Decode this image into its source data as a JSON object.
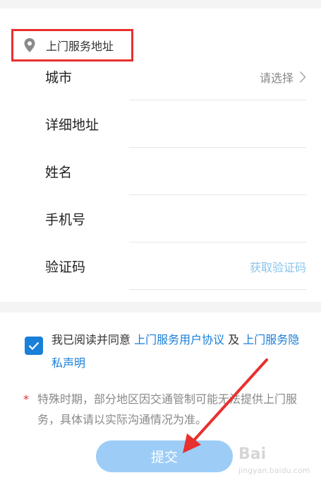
{
  "section": {
    "title": "上门服务地址",
    "icon": "map-pin-icon"
  },
  "fields": [
    {
      "label": "城市",
      "placeholder": "请选择"
    },
    {
      "label": "详细地址"
    },
    {
      "label": "姓名"
    },
    {
      "label": "手机号"
    },
    {
      "label": "验证码",
      "action": "获取验证码"
    }
  ],
  "agreement": {
    "checked": true,
    "prefix": "我已阅读并同意 ",
    "link1": "上门服务用户协议",
    "middle": " 及 ",
    "link2": "上门服务隐私声明"
  },
  "notice": {
    "star": "*",
    "text": "特殊时期，部分地区因交通管制可能无法提供上门服务，具体请以实际沟通情况为准。"
  },
  "submit": {
    "label": "提交"
  },
  "watermark": {
    "brand": "Bai",
    "sub": "jingyan.baidu.com"
  },
  "colors": {
    "accent": "#1a7fd8",
    "highlight": "#e8302f",
    "button": "#9dcdf7"
  }
}
